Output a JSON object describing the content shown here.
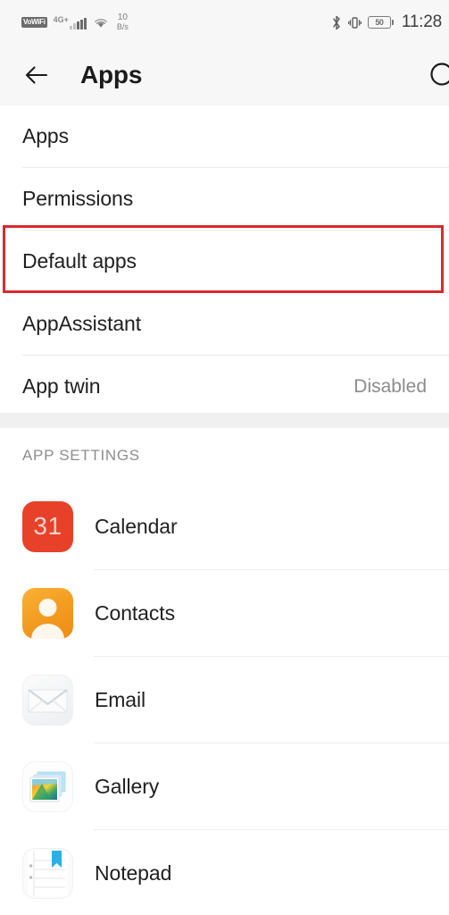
{
  "statusbar": {
    "vowifi_badge": "VoWiFi",
    "network_label": "4G+",
    "data_rate_value": "10",
    "data_rate_unit": "B/s",
    "battery_level": "50",
    "time": "11:28",
    "icons": {
      "signal": "signal-bars-icon",
      "wifi": "wifi-icon",
      "bluetooth": "bluetooth-icon",
      "vibrate": "vibrate-icon",
      "battery": "battery-icon"
    }
  },
  "appbar": {
    "title": "Apps",
    "back_icon": "back-arrow-icon",
    "search_icon": "search-icon"
  },
  "settings_list": [
    {
      "label": "Apps",
      "value": ""
    },
    {
      "label": "Permissions",
      "value": ""
    },
    {
      "label": "Default apps",
      "value": "",
      "highlighted": true
    },
    {
      "label": "AppAssistant",
      "value": ""
    },
    {
      "label": "App twin",
      "value": "Disabled"
    }
  ],
  "section": {
    "header": "APP SETTINGS"
  },
  "app_list": [
    {
      "name": "Calendar",
      "icon": "calendar-icon",
      "icon_text": "31"
    },
    {
      "name": "Contacts",
      "icon": "contacts-icon"
    },
    {
      "name": "Email",
      "icon": "email-icon"
    },
    {
      "name": "Gallery",
      "icon": "gallery-icon"
    },
    {
      "name": "Notepad",
      "icon": "notepad-icon"
    }
  ],
  "colors": {
    "highlight_border": "#d62b31",
    "calendar_red": "#e8412a",
    "contacts_orange": "#f29a20",
    "header_bg": "#f7f7f7",
    "gap_band": "#f0f0f0",
    "value_text": "#8c8c8c"
  }
}
